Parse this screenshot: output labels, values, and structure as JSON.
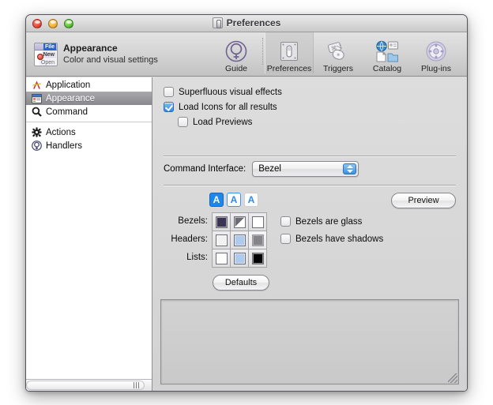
{
  "window": {
    "title": "Preferences",
    "title_icon": "switch-icon",
    "traffic_lights": [
      "close",
      "minimize",
      "zoom"
    ]
  },
  "header": {
    "app_icon": "menu-file-icon",
    "icon_tags": {
      "file": "File",
      "new": "New",
      "open": "Open"
    },
    "title": "Appearance",
    "subtitle": "Color and visual settings"
  },
  "toolbar": {
    "items": [
      {
        "label": "Guide",
        "icon": "guide-venus-icon",
        "selected": false
      },
      {
        "label": "Preferences",
        "icon": "light-switch-icon",
        "selected": true
      },
      {
        "label": "Triggers",
        "icon": "mouse-keys-icon",
        "selected": false
      },
      {
        "label": "Catalog",
        "icon": "globe-card-file-folder-icon",
        "selected": false
      },
      {
        "label": "Plug-ins",
        "icon": "puzzle-gear-icon",
        "selected": false
      }
    ]
  },
  "sidebar": {
    "items": [
      {
        "label": "Application",
        "icon": "letter-a-icon",
        "selected": false
      },
      {
        "label": "Appearance",
        "icon": "window-ui-icon",
        "selected": true
      },
      {
        "label": "Command",
        "icon": "magnifier-icon",
        "selected": false
      },
      {
        "label": "Actions",
        "icon": "gear-icon",
        "selected": false
      },
      {
        "label": "Handlers",
        "icon": "venus-badge-icon",
        "selected": false
      }
    ],
    "divider_after_index": 2,
    "scrollbar": {
      "orientation": "horizontal",
      "grip": "grip-lines"
    }
  },
  "main": {
    "checkboxes": [
      {
        "label": "Superfluous visual effects",
        "checked": false,
        "indent": 0
      },
      {
        "label": "Load Icons for all results",
        "checked": true,
        "indent": 0
      },
      {
        "label": "Load Previews",
        "checked": false,
        "indent": 1
      }
    ],
    "command_interface": {
      "label": "Command Interface:",
      "value": "Bezel",
      "options": [
        "Bezel"
      ],
      "control": "popup-button"
    },
    "preview_button": "Preview",
    "defaults_button": "Defaults",
    "text_sizes": [
      {
        "glyph": "A",
        "selected": true
      },
      {
        "glyph": "A",
        "selected": false
      },
      {
        "glyph": "A",
        "selected": false
      }
    ],
    "swatch_rows": [
      {
        "label": "Bezels:",
        "cells": [
          {
            "style": "sw-navy",
            "name": "swatch-dark-navy",
            "selected": false
          },
          {
            "style": "sw-diag",
            "name": "swatch-diagonal-gray",
            "selected": false
          },
          {
            "style": "sw-white",
            "name": "swatch-white",
            "selected": false
          }
        ]
      },
      {
        "label": "Headers:",
        "cells": [
          {
            "style": "sw-offw",
            "name": "swatch-off-white",
            "selected": false
          },
          {
            "style": "sw-blue",
            "name": "swatch-light-blue",
            "selected": false
          },
          {
            "style": "sw-gray",
            "name": "swatch-gray",
            "selected": true
          }
        ]
      },
      {
        "label": "Lists:",
        "cells": [
          {
            "style": "sw-white",
            "name": "swatch-white",
            "selected": false
          },
          {
            "style": "sw-blue",
            "name": "swatch-light-blue",
            "selected": false
          },
          {
            "style": "sw-black",
            "name": "swatch-black",
            "selected": false
          }
        ]
      }
    ],
    "right_checkboxes": [
      {
        "label": "Bezels are glass",
        "checked": false
      },
      {
        "label": "Bezels have shadows",
        "checked": false
      }
    ],
    "preview_panel": {
      "content": "",
      "resize_grip": "resize-grip-icon"
    }
  },
  "colors": {
    "accent_blue": "#2f8ae6",
    "selection_gray": "#88888d",
    "window_chrome": "#d6d6d6",
    "swatch_navy": "#3a3354",
    "swatch_light_blue": "#aecbee"
  }
}
